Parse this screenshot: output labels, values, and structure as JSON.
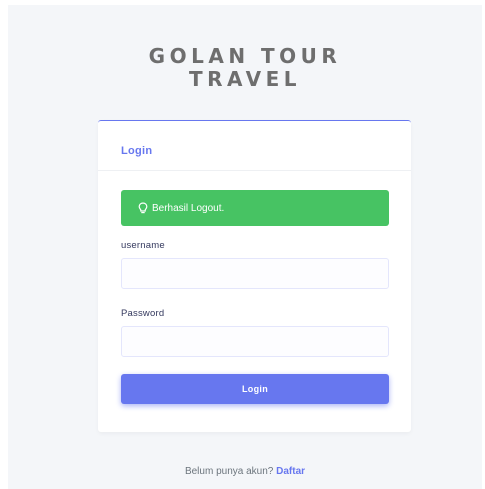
{
  "brand": {
    "line1": "GOLAN TOUR",
    "line2": "TRAVEL"
  },
  "card": {
    "title": "Login"
  },
  "alert": {
    "message": "Berhasil Logout.",
    "icon": "lightbulb-icon",
    "color": "#47c363"
  },
  "form": {
    "username_label": "username",
    "username_value": "",
    "password_label": "Password",
    "password_value": "",
    "submit_label": "Login"
  },
  "footer": {
    "prompt": "Belum punya akun?",
    "link_label": "Daftar"
  },
  "colors": {
    "primary": "#6777ef",
    "success": "#47c363",
    "background": "#f4f6f9"
  }
}
